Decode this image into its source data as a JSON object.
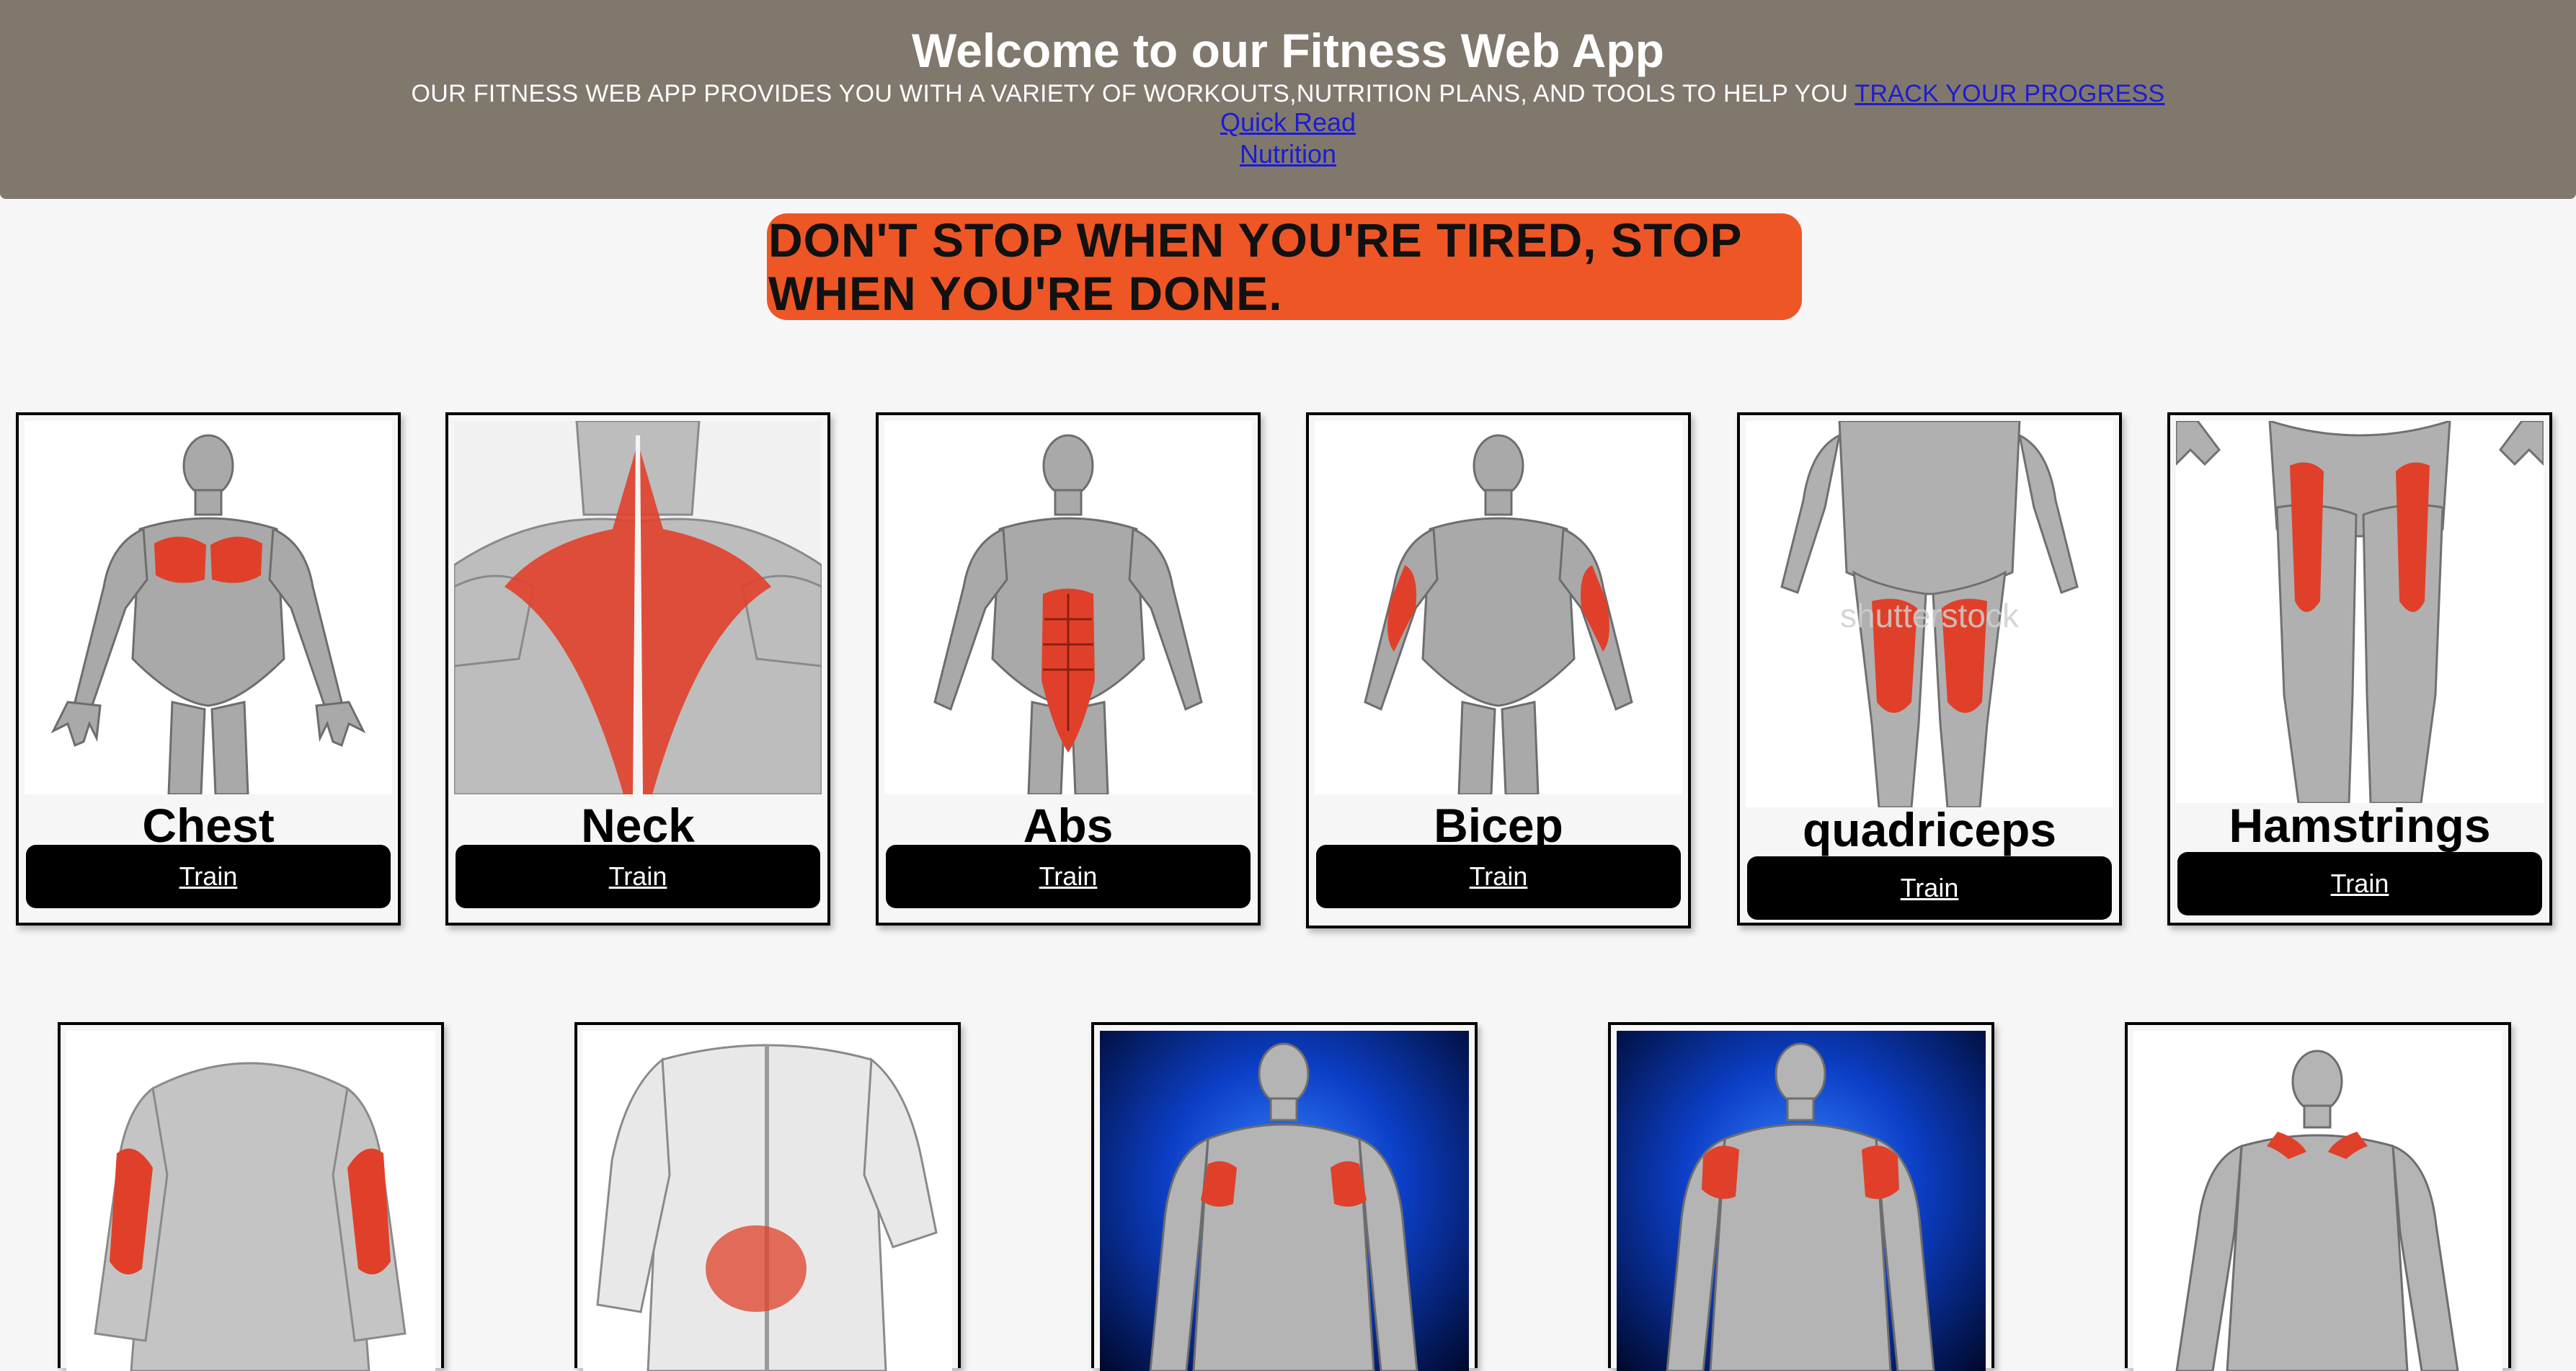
{
  "header": {
    "title": "Welcome to our Fitness Web App",
    "tagline": "OUR FITNESS WEB APP PROVIDES YOU WITH A VARIETY OF WORKOUTS,NUTRITION PLANS, AND TOOLS TO HELP YOU",
    "track_link": "TRACK YOUR PROGRESS",
    "quick_read_link": "Quick Read",
    "nutrition_link": "Nutrition"
  },
  "quote": {
    "line1": "DON'T STOP WHEN YOU'RE TIRED, STOP",
    "line2": "WHEN YOU'RE DONE."
  },
  "cards": [
    {
      "name": "Chest",
      "button": "Train"
    },
    {
      "name": "Neck",
      "button": "Train"
    },
    {
      "name": "Abs",
      "button": "Train"
    },
    {
      "name": "Bicep",
      "button": "Train"
    },
    {
      "name": "quadriceps",
      "button": "Train"
    },
    {
      "name": "Hamstrings",
      "button": "Train"
    }
  ],
  "watermark": "shutterstock",
  "colors": {
    "header_bg": "#80786d",
    "quote_bg": "#ee5626",
    "link": "#1d1bd3",
    "muscle": "#e0402a",
    "page_bg": "#f6f6f6"
  }
}
